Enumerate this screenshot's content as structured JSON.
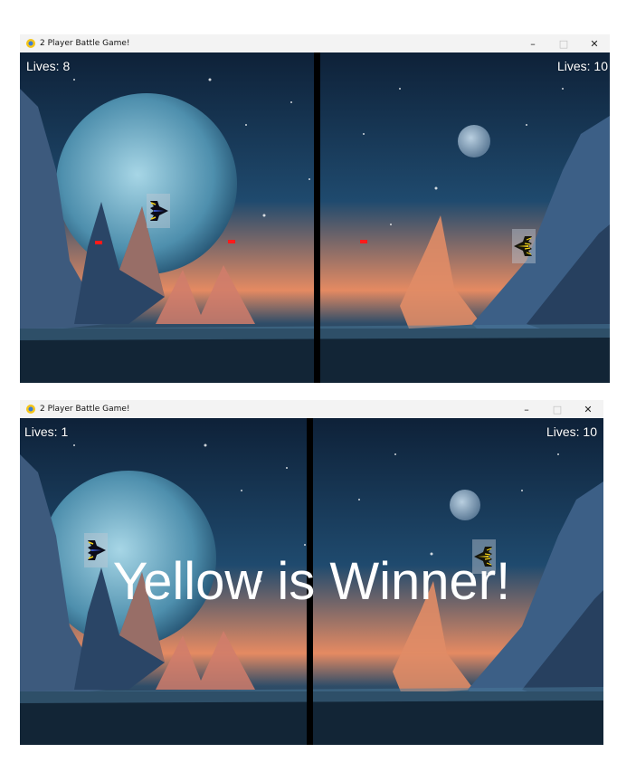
{
  "app_title": "2 Player Battle Game!",
  "window_controls": {
    "minimize": "–",
    "maximize": "□",
    "close": "✕"
  },
  "screens": [
    {
      "lives_left": "Lives: 8",
      "lives_right": "Lives: 10"
    },
    {
      "lives_left": "Lives: 1",
      "lives_right": "Lives: 10",
      "winner_text": "Yellow is Winner!"
    }
  ],
  "colors": {
    "bullet": "#ff1a1a",
    "divider": "#000000",
    "yellow_ship": "#f2d21a",
    "blue_ship": "#3d5bd6"
  },
  "icons": [
    "pygame-app-icon",
    "minimize-icon",
    "maximize-icon",
    "close-icon",
    "yellow-spaceship-icon",
    "blue-spaceship-icon"
  ]
}
